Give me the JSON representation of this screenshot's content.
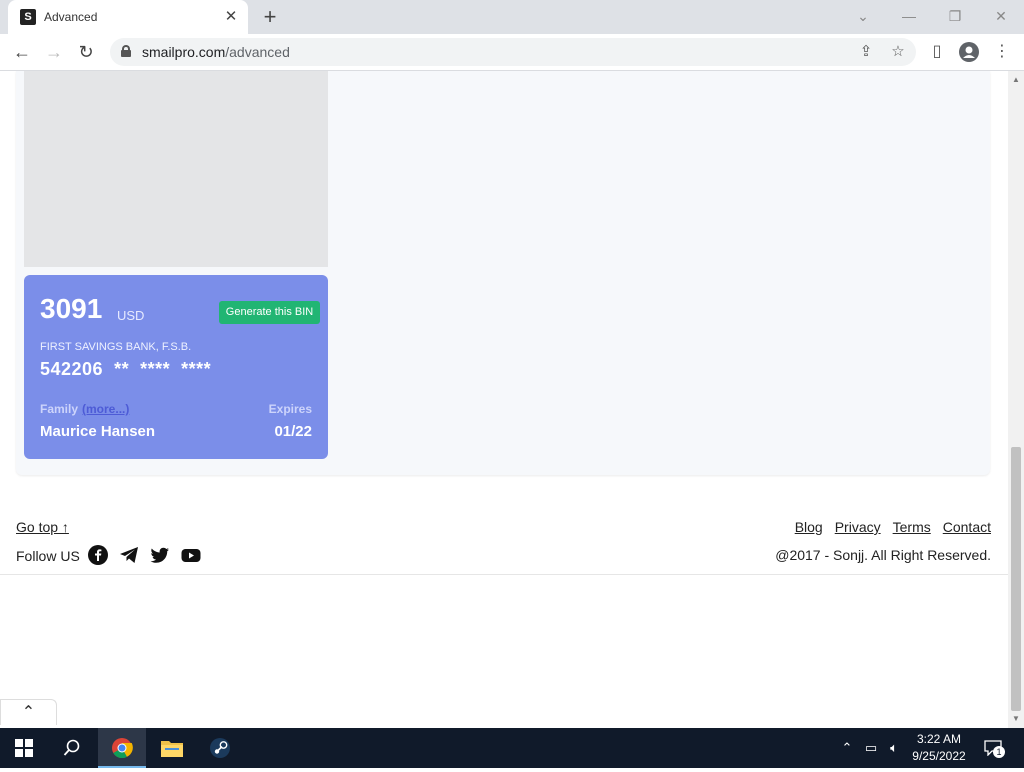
{
  "browser": {
    "tab_title": "Advanced",
    "favicon_letter": "S",
    "url_host": "smailpro.com",
    "url_path": "/advanced"
  },
  "card": {
    "amount": "3091",
    "currency": "USD",
    "generate_label": "Generate this BIN",
    "bank_name": "FIRST SAVINGS BANK, F.S.B.",
    "card_number": "542206  **  ****  ****",
    "family_label": "Family",
    "more_label": "(more...)",
    "holder_name": "Maurice Hansen",
    "expires_label": "Expires",
    "expires_value": "01/22"
  },
  "footer": {
    "go_top": "Go top ↑",
    "follow_label": "Follow US",
    "links": [
      "Blog",
      "Privacy",
      "Terms",
      "Contact"
    ],
    "copyright": "@2017 - Sonjj. All Right Reserved."
  },
  "taskbar": {
    "time": "3:22 AM",
    "date": "9/25/2022",
    "notification_count": "1"
  },
  "colors": {
    "card_bg": "#7b8ee9",
    "generate_btn": "#21b573",
    "taskbar_bg": "#101a2a"
  }
}
